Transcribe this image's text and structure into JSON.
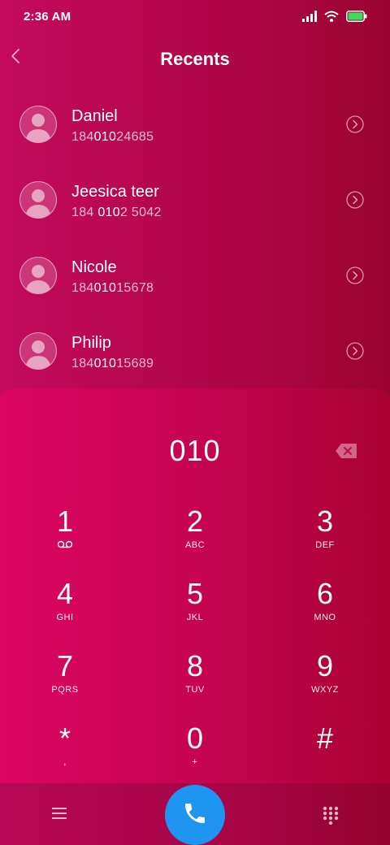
{
  "status_bar": {
    "time": "2:36 AM",
    "icons": [
      "signal-icon",
      "wifi-icon",
      "battery-icon"
    ]
  },
  "header": {
    "title": "Recents",
    "back_icon": "chevron-left-icon"
  },
  "recents": [
    {
      "name": "Daniel",
      "number_pre": "184",
      "number_match": "010",
      "number_post": "24685"
    },
    {
      "name": "Jeesica teer",
      "number_pre": "184 ",
      "number_match": "010",
      "number_post": "2 5042"
    },
    {
      "name": "Nicole",
      "number_pre": "184",
      "number_match": "010",
      "number_post": "15678"
    },
    {
      "name": "Philip",
      "number_pre": "184",
      "number_match": "010",
      "number_post": "15689"
    }
  ],
  "dialpad": {
    "input": "010",
    "keys": [
      {
        "digit": "1",
        "letters": ""
      },
      {
        "digit": "2",
        "letters": "ABC"
      },
      {
        "digit": "3",
        "letters": "DEF"
      },
      {
        "digit": "4",
        "letters": "GHI"
      },
      {
        "digit": "5",
        "letters": "JKL"
      },
      {
        "digit": "6",
        "letters": "MNO"
      },
      {
        "digit": "7",
        "letters": "PQRS"
      },
      {
        "digit": "8",
        "letters": "TUV"
      },
      {
        "digit": "9",
        "letters": "WXYZ"
      },
      {
        "digit": "*",
        "letters": ","
      },
      {
        "digit": "0",
        "letters": "+"
      },
      {
        "digit": "#",
        "letters": ""
      }
    ]
  },
  "colors": {
    "accent_call": "#1e95f0",
    "background": "#b00648",
    "battery": "#3ddc5a"
  }
}
